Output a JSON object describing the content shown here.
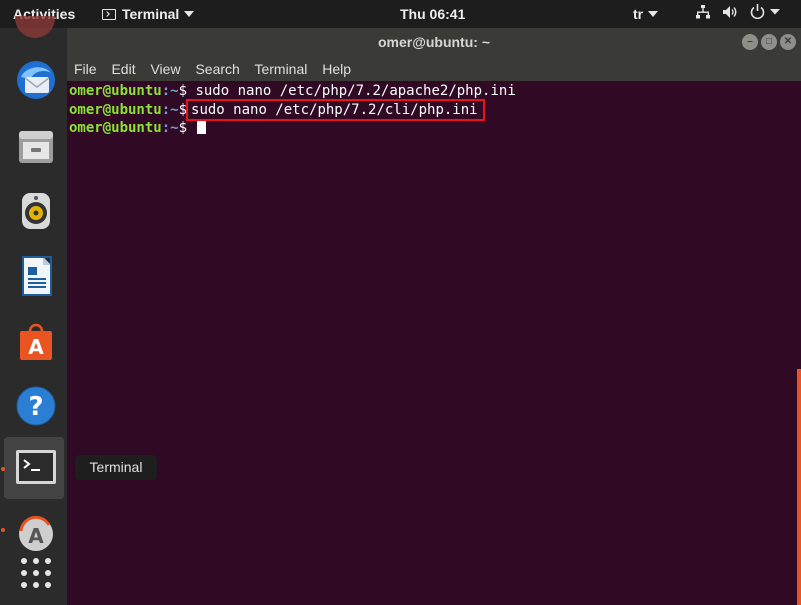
{
  "topbar": {
    "activities": "Activities",
    "app_menu": "Terminal",
    "clock": "Thu 06:41",
    "input_source": "tr",
    "icons": [
      "terminal-app-icon",
      "network-icon",
      "volume-icon",
      "power-icon"
    ]
  },
  "dock": {
    "items": [
      {
        "name": "thunderbird",
        "icon": "mail-icon"
      },
      {
        "name": "files",
        "icon": "file-cabinet-icon"
      },
      {
        "name": "rhythmbox",
        "icon": "speaker-icon"
      },
      {
        "name": "libreoffice-writer",
        "icon": "document-icon"
      },
      {
        "name": "ubuntu-software",
        "icon": "shopping-bag-icon"
      },
      {
        "name": "help",
        "icon": "question-icon"
      },
      {
        "name": "terminal",
        "icon": "terminal-icon",
        "active": true
      },
      {
        "name": "software-updater",
        "icon": "updater-icon"
      },
      {
        "name": "show-applications",
        "icon": "app-grid-icon"
      }
    ],
    "tooltip": "Terminal"
  },
  "window": {
    "title": "omer@ubuntu: ~",
    "menu": [
      "File",
      "Edit",
      "View",
      "Search",
      "Terminal",
      "Help"
    ],
    "terminal": {
      "prompt_user": "omer@ubuntu",
      "prompt_path": ":~",
      "prompt_symbol": "$",
      "lines": [
        {
          "command": "sudo nano /etc/php/7.2/apache2/php.ini"
        },
        {
          "command": "sudo nano /etc/php/7.2/cli/php.ini",
          "highlighted": true
        },
        {
          "command": ""
        }
      ]
    }
  },
  "colors": {
    "terminal_bg": "#300a24",
    "prompt_user": "#8ae234",
    "prompt_path": "#729fcf",
    "highlight_box": "#e8141c",
    "accent": "#e95420"
  }
}
